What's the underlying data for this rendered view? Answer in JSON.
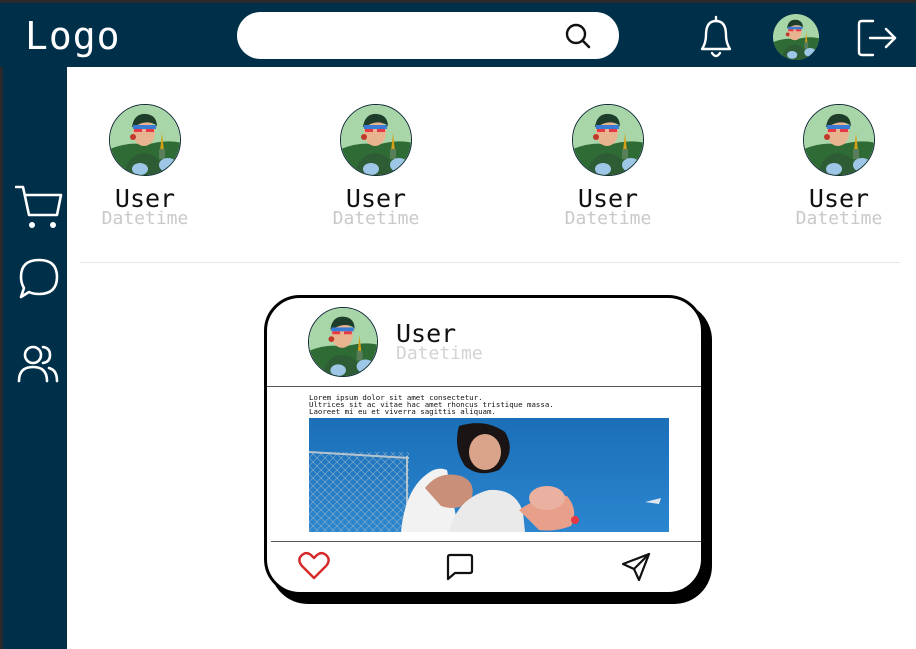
{
  "header": {
    "logo": "Logo",
    "search": {
      "value": "",
      "placeholder": "",
      "icon": "search-icon"
    },
    "notifications_icon": "bell-icon",
    "logout_icon": "logout-icon"
  },
  "sidebar": {
    "items": [
      {
        "icon": "cart-icon"
      },
      {
        "icon": "chat-bubble-icon"
      },
      {
        "icon": "users-icon"
      }
    ]
  },
  "stories": [
    {
      "user": "User",
      "datetime": "Datetime"
    },
    {
      "user": "User",
      "datetime": "Datetime"
    },
    {
      "user": "User",
      "datetime": "Datetime"
    },
    {
      "user": "User",
      "datetime": "Datetime"
    }
  ],
  "post": {
    "user": "User",
    "datetime": "Datetime",
    "text": [
      "Lorem ipsum dolor sit amet consectetur.",
      "Ultrices sit ac vitae hac amet rhoncus tristique massa.",
      "Laoreet mi eu et viverra sagittis aliquam."
    ],
    "actions": {
      "like_icon": "heart-icon",
      "comment_icon": "comment-icon",
      "share_icon": "send-icon"
    }
  },
  "colors": {
    "primary": "#003049",
    "like": "#d62828",
    "muted_text": "#c9c9c9"
  }
}
